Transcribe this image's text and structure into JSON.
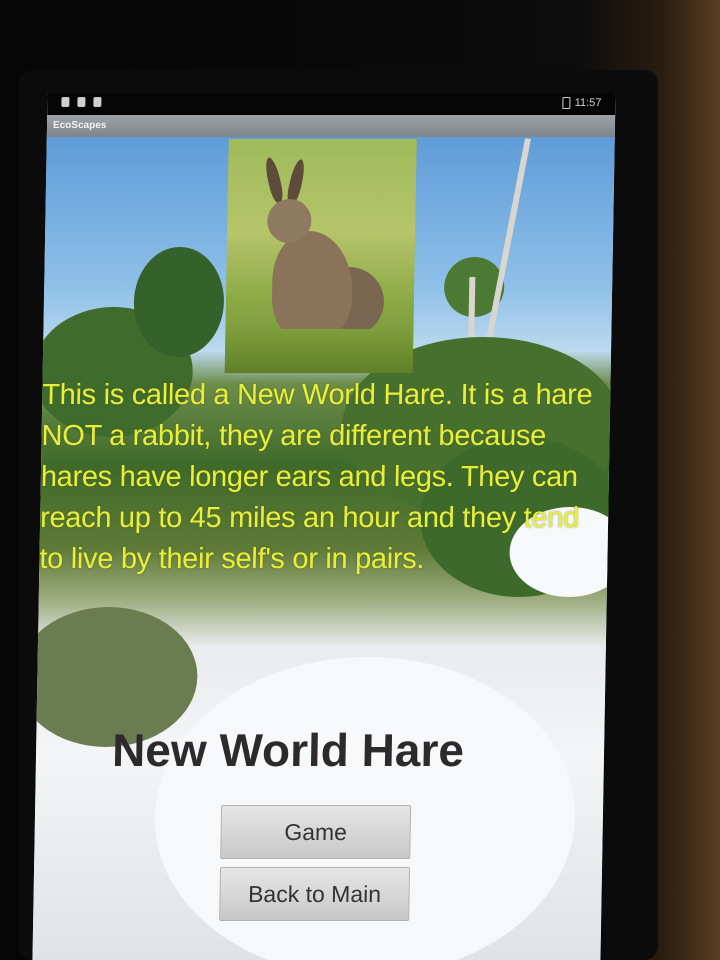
{
  "status_bar": {
    "time": "11:57"
  },
  "app": {
    "title": "EcoScapes"
  },
  "content": {
    "description": "This is called a New World Hare. It is a hare NOT a rabbit, they are different because hares have longer ears and legs. They can reach up to 45 miles an hour and they tend to live by their self's or in pairs.",
    "title": "New World Hare"
  },
  "buttons": {
    "game_label": "Game",
    "back_label": "Back to Main"
  },
  "colors": {
    "description_text": "#e7ef3d",
    "title_text": "#2c2a2b",
    "title_bar": "#8b9194"
  },
  "icons": {
    "status_left": [
      "notification-icon",
      "sd-card-icon",
      "notification-icon"
    ],
    "status_right": "battery-icon"
  }
}
